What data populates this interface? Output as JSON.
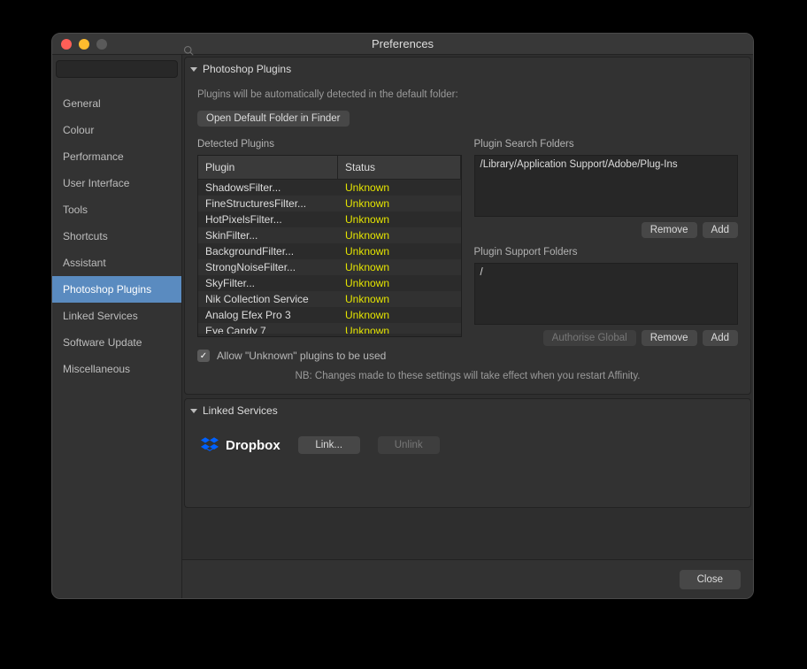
{
  "window": {
    "title": "Preferences"
  },
  "sidebar": {
    "search_placeholder": "",
    "items": [
      {
        "label": "General"
      },
      {
        "label": "Colour"
      },
      {
        "label": "Performance"
      },
      {
        "label": "User Interface"
      },
      {
        "label": "Tools"
      },
      {
        "label": "Shortcuts"
      },
      {
        "label": "Assistant"
      },
      {
        "label": "Photoshop Plugins"
      },
      {
        "label": "Linked Services"
      },
      {
        "label": "Software Update"
      },
      {
        "label": "Miscellaneous"
      }
    ],
    "active_index": 7
  },
  "plugins_section": {
    "title": "Photoshop Plugins",
    "hint": "Plugins will be automatically detected in the default folder:",
    "open_folder_btn": "Open Default Folder in Finder",
    "detected_label": "Detected Plugins",
    "table_headers": {
      "plugin": "Plugin",
      "status": "Status"
    },
    "rows": [
      {
        "name": "ShadowsFilter...",
        "status": "Unknown"
      },
      {
        "name": "FineStructuresFilter...",
        "status": "Unknown"
      },
      {
        "name": "HotPixelsFilter...",
        "status": "Unknown"
      },
      {
        "name": "SkinFilter...",
        "status": "Unknown"
      },
      {
        "name": "BackgroundFilter...",
        "status": "Unknown"
      },
      {
        "name": "StrongNoiseFilter...",
        "status": "Unknown"
      },
      {
        "name": "SkyFilter...",
        "status": "Unknown"
      },
      {
        "name": "Nik Collection Service",
        "status": "Unknown"
      },
      {
        "name": "Analog Efex Pro 3",
        "status": "Unknown"
      },
      {
        "name": "Eye Candy 7",
        "status": "Unknown"
      }
    ],
    "search_folders_label": "Plugin Search Folders",
    "search_folders": [
      "/Library/Application Support/Adobe/Plug-Ins"
    ],
    "support_folders_label": "Plugin Support Folders",
    "support_folders": [
      "/"
    ],
    "remove_btn": "Remove",
    "add_btn": "Add",
    "authorise_btn": "Authorise Global",
    "allow_unknown_label": "Allow \"Unknown\" plugins to be used",
    "allow_unknown_checked": true,
    "note": "NB: Changes made to these settings will take effect when you restart Affinity."
  },
  "linked_section": {
    "title": "Linked Services",
    "service_name": "Dropbox",
    "link_btn": "Link...",
    "unlink_btn": "Unlink"
  },
  "footer": {
    "close_btn": "Close"
  }
}
